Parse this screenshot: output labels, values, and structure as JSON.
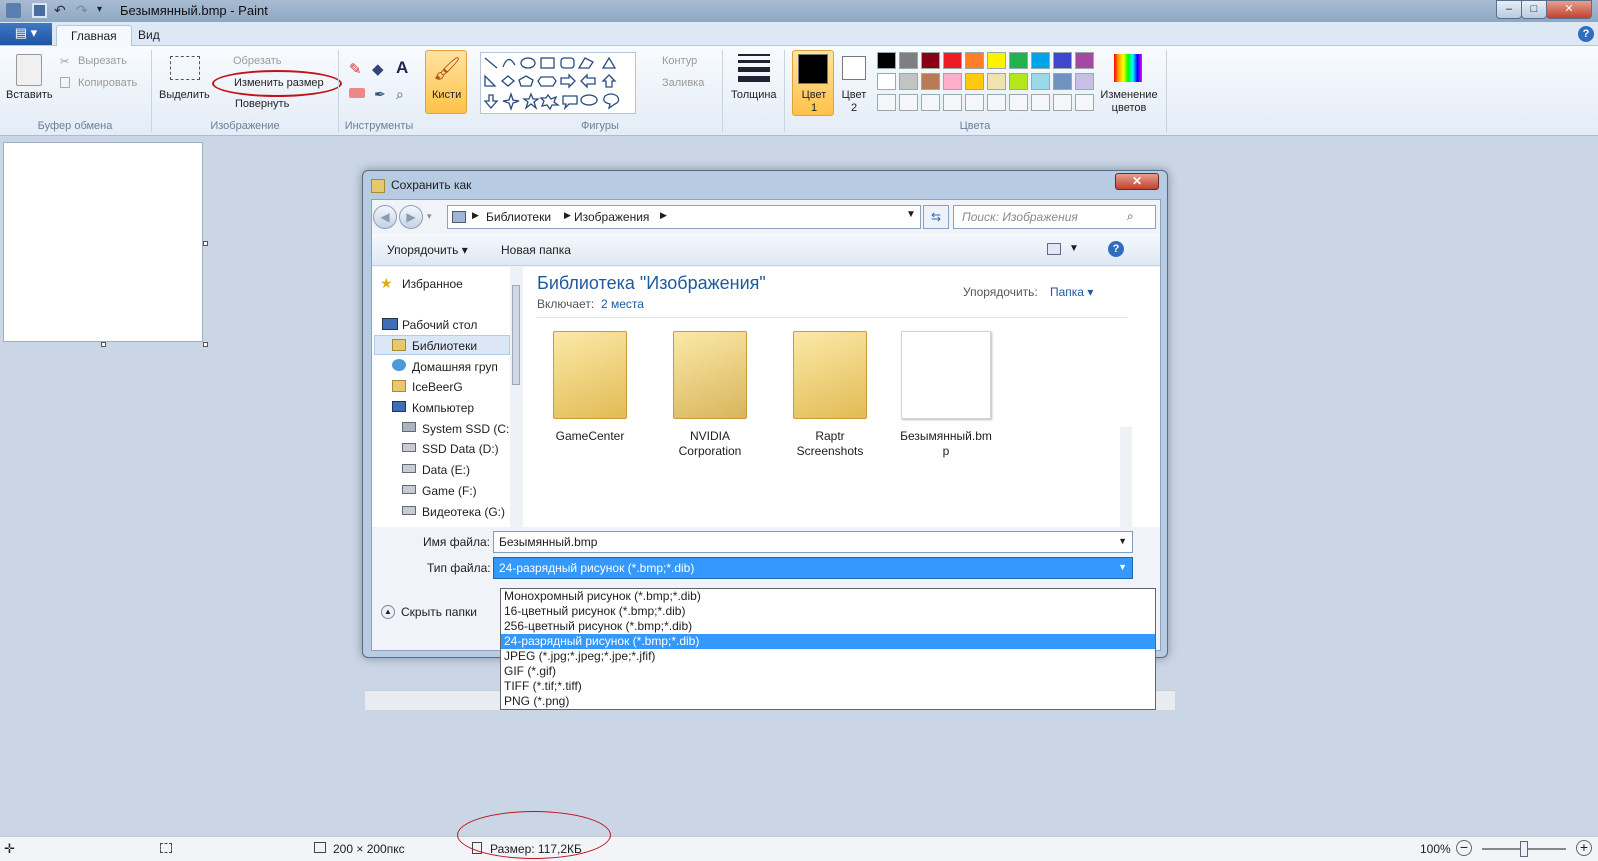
{
  "window": {
    "title": "Безымянный.bmp - Paint"
  },
  "tabs": {
    "file_menu": "▤ ▾",
    "home": "Главная",
    "view": "Вид"
  },
  "ribbon": {
    "clipboard": {
      "group": "Буфер обмена",
      "paste": "Вставить",
      "cut": "Вырезать",
      "copy": "Копировать"
    },
    "image": {
      "group": "Изображение",
      "select": "Выделить",
      "crop": "Обрезать",
      "resize": "Изменить размер",
      "rotate": "Повернуть"
    },
    "tools": {
      "group": "Инструменты"
    },
    "brushes": "Кисти",
    "shapes": {
      "group": "Фигуры",
      "outline": "Контур",
      "fill": "Заливка"
    },
    "thickness": "Толщина",
    "color1": "Цвет 1",
    "color2": "Цвет 2",
    "colors": {
      "group": "Цвета",
      "edit": "Изменение цветов",
      "palette_row1": [
        "#000000",
        "#7f7f7f",
        "#880015",
        "#ed1c24",
        "#ff7f27",
        "#fff200",
        "#22b14c",
        "#00a2e8",
        "#3f48cc",
        "#a349a4"
      ],
      "palette_row2": [
        "#ffffff",
        "#c3c3c3",
        "#b97a57",
        "#ffaec9",
        "#ffc90e",
        "#efe4b0",
        "#b5e61d",
        "#99d9ea",
        "#7092be",
        "#c8bfe7"
      ]
    }
  },
  "dialog": {
    "title": "Сохранить как",
    "close": "✕",
    "breadcrumb": [
      "Библиотеки",
      "Изображения"
    ],
    "search_placeholder": "Поиск: Изображения",
    "organize": "Упорядочить ▾",
    "new_folder": "Новая папка",
    "library_title": "Библиотека \"Изображения\"",
    "includes_label": "Включает:",
    "includes_value": "2 места",
    "arrange_label": "Упорядочить:",
    "arrange_value": "Папка ▾",
    "nav": {
      "favorites": "Избранное",
      "desktop": "Рабочий стол",
      "libraries": "Библиотеки",
      "homegroup": "Домашняя груп",
      "user": "IceBeerG",
      "computer": "Компьютер",
      "c": "System SSD (C:",
      "d": "SSD Data (D:)",
      "e": "Data (E:)",
      "f": "Game (F:)",
      "g": "Видеотека (G:)"
    },
    "items": [
      "GameCenter",
      "NVIDIA Corporation",
      "Raptr Screenshots",
      "Безымянный.bmp"
    ],
    "filename_label": "Имя файла:",
    "filename_value": "Безымянный.bmp",
    "filetype_label": "Тип файла:",
    "filetype_value": "24-разрядный рисунок (*.bmp;*.dib)",
    "hide_folders": "Скрыть папки",
    "filetype_options": [
      "Монохромный рисунок (*.bmp;*.dib)",
      "16-цветный рисунок (*.bmp;*.dib)",
      "256-цветный рисунок (*.bmp;*.dib)",
      "24-разрядный рисунок (*.bmp;*.dib)",
      "JPEG (*.jpg;*.jpeg;*.jpe;*.jfif)",
      "GIF (*.gif)",
      "TIFF (*.tif;*.tiff)",
      "PNG (*.png)"
    ],
    "filetype_selected_index": 3
  },
  "status": {
    "dimensions": "200 × 200пкс",
    "size": "Размер: 117,2КБ",
    "zoom": "100%"
  },
  "annotation_color": "#c0141c"
}
